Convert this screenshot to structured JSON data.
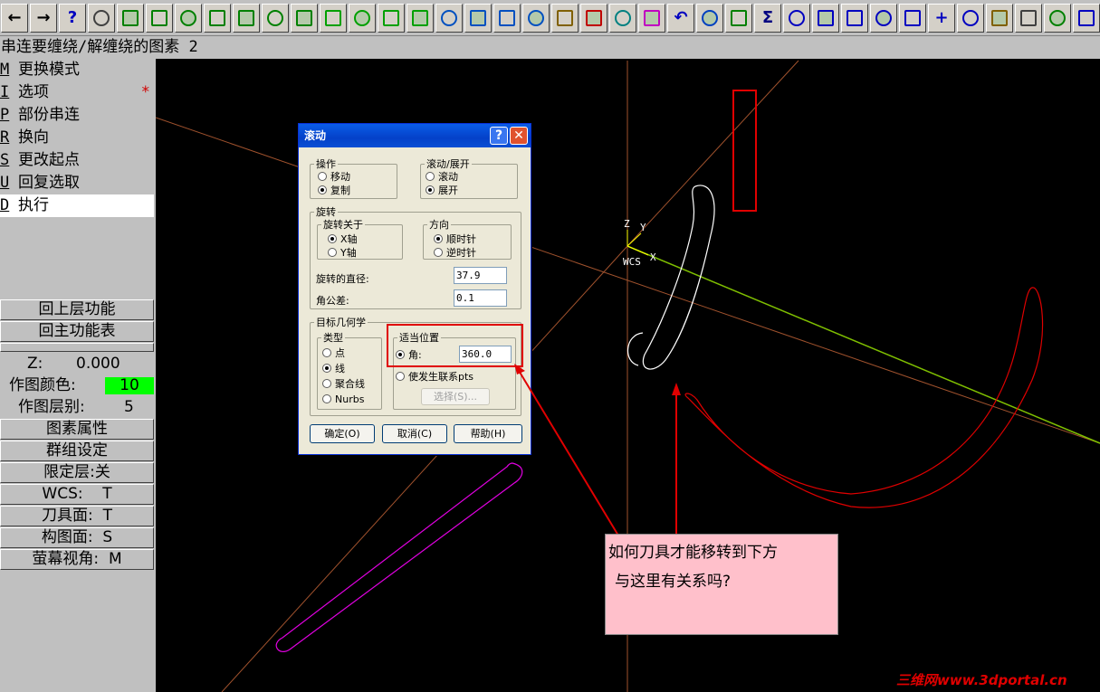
{
  "toolbar": {
    "items": [
      {
        "name": "arrow-left-icon",
        "glyph": "←"
      },
      {
        "name": "arrow-right-icon",
        "glyph": "→"
      },
      {
        "name": "help-icon",
        "glyph": "?"
      },
      {
        "name": "calculator-icon",
        "glyph": ""
      },
      {
        "name": "analyze-icon",
        "glyph": ""
      },
      {
        "name": "zoom-window-icon",
        "glyph": ""
      },
      {
        "name": "zoom-in-icon",
        "glyph": ""
      },
      {
        "name": "zoom-out-icon",
        "glyph": ""
      },
      {
        "name": "pan-icon",
        "glyph": ""
      },
      {
        "name": "zoom-select-icon",
        "glyph": ""
      },
      {
        "name": "view-iso-icon",
        "glyph": ""
      },
      {
        "name": "view-top-icon",
        "glyph": ""
      },
      {
        "name": "view-front-icon",
        "glyph": ""
      },
      {
        "name": "view-side-icon",
        "glyph": ""
      },
      {
        "name": "view-cube-icon",
        "glyph": ""
      },
      {
        "name": "view-cube-blue-icon",
        "glyph": ""
      },
      {
        "name": "view-cube-2-icon",
        "glyph": ""
      },
      {
        "name": "view-cube-3-icon",
        "glyph": ""
      },
      {
        "name": "view-cube-4-icon",
        "glyph": ""
      },
      {
        "name": "pencil-icon",
        "glyph": ""
      },
      {
        "name": "erase-icon",
        "glyph": ""
      },
      {
        "name": "transform-icon",
        "glyph": ""
      },
      {
        "name": "transform-2-icon",
        "glyph": ""
      },
      {
        "name": "undo-icon",
        "glyph": "↶"
      },
      {
        "name": "sphere-icon",
        "glyph": ""
      },
      {
        "name": "layers-icon",
        "glyph": ""
      },
      {
        "name": "sigma-icon",
        "glyph": "Σ"
      },
      {
        "name": "line-icon",
        "glyph": ""
      },
      {
        "name": "arc-icon",
        "glyph": ""
      },
      {
        "name": "fillet-icon",
        "glyph": ""
      },
      {
        "name": "spline-icon",
        "glyph": ""
      },
      {
        "name": "rectangle-icon",
        "glyph": ""
      },
      {
        "name": "point-icon",
        "glyph": "+"
      },
      {
        "name": "surface-icon",
        "glyph": ""
      },
      {
        "name": "solid-icon",
        "glyph": ""
      },
      {
        "name": "chain-icon",
        "glyph": ""
      },
      {
        "name": "trim-icon",
        "glyph": ""
      },
      {
        "name": "trim-2-icon",
        "glyph": ""
      },
      {
        "name": "trim-3-icon",
        "glyph": ""
      }
    ]
  },
  "prompt": "串连要缠绕/解缠绕的图素 2",
  "menu": {
    "items": [
      {
        "key": "M",
        "label": "更换模式"
      },
      {
        "key": "I",
        "label": "选项",
        "star": "*"
      },
      {
        "key": "P",
        "label": "部份串连"
      },
      {
        "key": "R",
        "label": "换向"
      },
      {
        "key": "S",
        "label": "更改起点"
      },
      {
        "key": "U",
        "label": "回复选取"
      },
      {
        "key": "D",
        "label": "执行",
        "selected": true
      }
    ]
  },
  "left": {
    "back_label": "回上层功能",
    "main_label": "回主功能表",
    "z_label": "Z:",
    "z_value": "0.000",
    "color_label": "作图颜色:",
    "color_value": "10",
    "level_label": "作图层别:",
    "level_value": "5",
    "attr_label": "图素属性",
    "group_label": "群组设定",
    "limit_label": "限定层:关",
    "wcs_label": "WCS:",
    "wcs_value": "T",
    "tplane_label": "刀具面:",
    "tplane_value": "T",
    "cplane_label": "构图面:",
    "cplane_value": "S",
    "gview_label": "萤幕视角:",
    "gview_value": "M",
    "color_swatch": "#00ff00"
  },
  "viewport": {
    "axis_z": "Z",
    "axis_y": "Y",
    "axis_x": "X",
    "wcs": "WCS"
  },
  "dialog": {
    "title": "滚动",
    "help": "?",
    "close": "✕",
    "op_legend": "操作",
    "op_move": "移动",
    "op_copy": "复制",
    "roll_legend": "滚动/展开",
    "roll_roll": "滚动",
    "roll_unroll": "展开",
    "rot_legend": "旋转",
    "rot_about_legend": "旋转关于",
    "rot_x": "X轴",
    "rot_y": "Y轴",
    "dir_legend": "方向",
    "dir_cw": "顺时针",
    "dir_ccw": "逆时针",
    "diameter_label": "旋转的直径:",
    "diameter_value": "37.9",
    "tol_label": "角公差:",
    "tol_value": "0.1",
    "target_legend": "目标几何学",
    "type_legend": "类型",
    "type_point": "点",
    "type_line": "线",
    "type_polyline": "聚合线",
    "type_nurbs": "Nurbs",
    "pos_legend": "适当位置",
    "angle_label": "角:",
    "angle_value": "360.0",
    "assoc_label": "使发生联系pts",
    "select_label": "选择(S)...",
    "ok": "确定(O)",
    "cancel": "取消(C)",
    "helpbtn": "帮助(H)"
  },
  "note": {
    "line1": "如何刀具才能移转到下方",
    "line2": "与这里有关系吗?"
  },
  "watermark": "三维网www.3dportal.cn",
  "colors": {
    "highlight": "#e00000",
    "note_bg": "#ffc0cb",
    "title_blue": "#0441c9"
  }
}
